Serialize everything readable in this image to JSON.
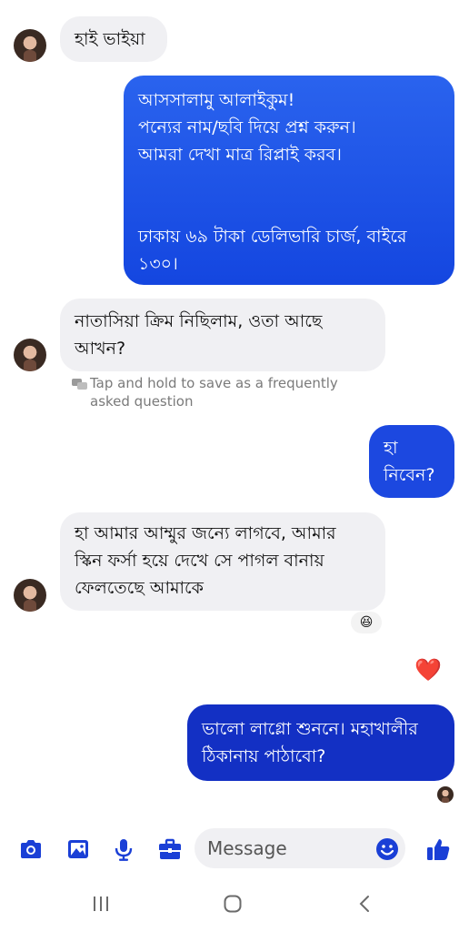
{
  "messages": {
    "m1": "হাই ভাইয়া",
    "m2": "আসসালামু আলাইকুম!\nপন্যের নাম/ছবি দিয়ে প্রশ্ন করুন।\nআমরা দেখা মাত্র রিপ্লাই করব।\n\n\nঢাকায় ৬৯ টাকা ডেলিভারি চার্জ, বাইরে\n১৩০।",
    "m3": "নাতাসিয়া ক্রিম নিছিলাম, ওতা আছে\nআখন?",
    "hint": "Tap and hold to save as a frequently\nasked question",
    "m4": "হা\nনিবেন?",
    "m5": "হা আমার আম্মুর জন্যে লাগবে, আমার\nস্কিন ফর্সা হয়ে দেখে সে পাগল বানায়\nফেলতেছে আমাকে",
    "m6": "ভালো লাগ্লো শুননে। মহাখালীর\nঠিকানায় পাঠাবো?",
    "reaction": "😆",
    "heart": "❤️"
  },
  "composer": {
    "placeholder": "Message"
  },
  "colors": {
    "accent": "#1a3fd6",
    "incoming_bg": "#f0f0f3"
  },
  "icons": [
    "camera-icon",
    "image-icon",
    "mic-icon",
    "briefcase-icon",
    "emoji-icon",
    "thumbs-up-icon"
  ],
  "navbar": [
    "recent-apps-icon",
    "home-icon",
    "back-icon"
  ]
}
